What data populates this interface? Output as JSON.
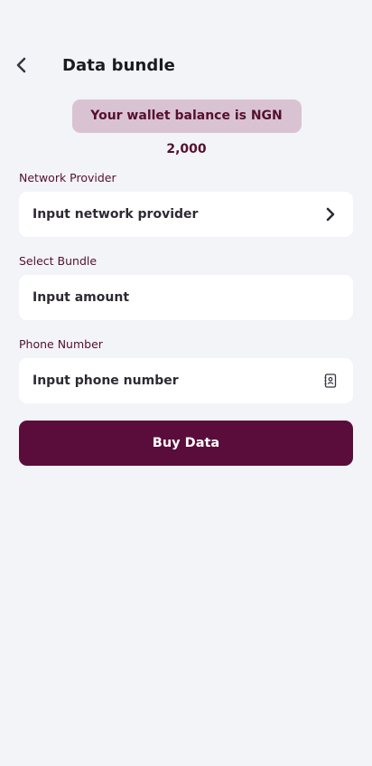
{
  "header": {
    "title": "Data bundle",
    "back_icon": "chevron-left-icon"
  },
  "wallet": {
    "balance_text": "Your wallet balance is NGN 2,000"
  },
  "form": {
    "network_provider": {
      "label": "Network Provider",
      "placeholder": "Input network provider",
      "icon": "chevron-right-icon"
    },
    "bundle": {
      "label": "Select Bundle",
      "placeholder": "Input amount"
    },
    "phone": {
      "label": "Phone Number",
      "placeholder": "Input phone number",
      "icon": "contact-book-icon"
    },
    "submit_label": "Buy Data"
  },
  "colors": {
    "background": "#F3F4F8",
    "primary": "#5A0D3A",
    "pill_bg": "#D9C3D3",
    "label_text": "#55102F"
  }
}
